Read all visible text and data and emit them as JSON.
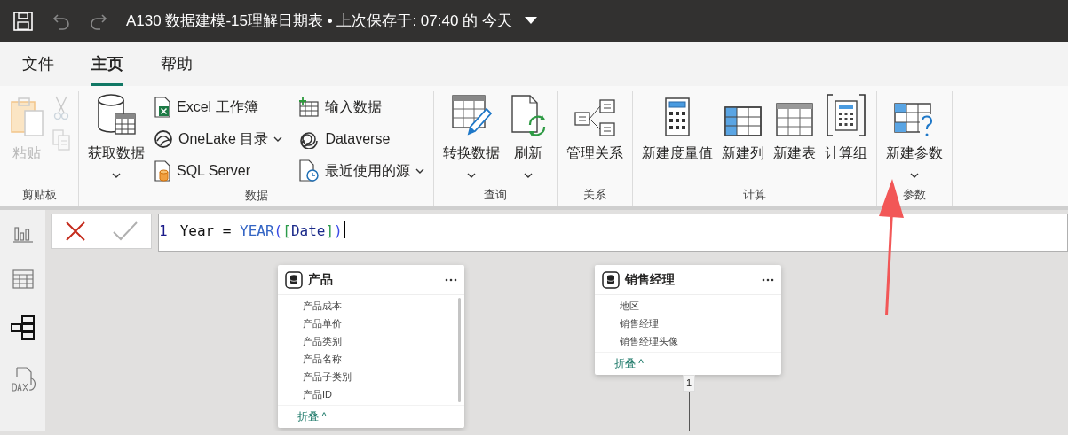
{
  "title_bar": {
    "title": "A130 数据建模-15理解日期表 • 上次保存于: 07:40 的 今天"
  },
  "menu_tabs": [
    {
      "label": "文件",
      "selected": false
    },
    {
      "label": "主页",
      "selected": true
    },
    {
      "label": "帮助",
      "selected": false
    }
  ],
  "ribbon": {
    "groups": [
      {
        "label": "剪贴板",
        "buttons": [
          {
            "kind": "large",
            "label": "粘贴",
            "disabled": true,
            "dropdown": false
          },
          {
            "kind": "icon",
            "disabled": true
          },
          {
            "kind": "icon",
            "disabled": true
          }
        ]
      },
      {
        "label": "数据",
        "buttons": [
          {
            "kind": "large",
            "label": "获取数据",
            "disabled": false,
            "dropdown": true
          },
          {
            "kind": "small",
            "label": "Excel 工作簿",
            "disabled": false,
            "dropdown": false
          },
          {
            "kind": "small",
            "label": "OneLake 目录",
            "disabled": false,
            "dropdown": true
          },
          {
            "kind": "small",
            "label": "SQL Server",
            "disabled": false,
            "dropdown": false
          },
          {
            "kind": "small",
            "label": "输入数据",
            "disabled": false,
            "dropdown": false
          },
          {
            "kind": "small",
            "label": "Dataverse",
            "disabled": false,
            "dropdown": false
          },
          {
            "kind": "small",
            "label": "最近使用的源",
            "disabled": false,
            "dropdown": true
          }
        ]
      },
      {
        "label": "查询",
        "buttons": [
          {
            "kind": "large",
            "label": "转换数据",
            "disabled": false,
            "dropdown": true
          },
          {
            "kind": "large",
            "label": "刷新",
            "disabled": false,
            "dropdown": true
          }
        ]
      },
      {
        "label": "关系",
        "buttons": [
          {
            "kind": "large",
            "label": "管理关系",
            "disabled": false,
            "dropdown": false
          }
        ]
      },
      {
        "label": "计算",
        "buttons": [
          {
            "kind": "large",
            "label": "新建度量值",
            "disabled": false,
            "dropdown": false
          },
          {
            "kind": "large",
            "label": "新建列",
            "disabled": false,
            "dropdown": false
          },
          {
            "kind": "large",
            "label": "新建表",
            "disabled": false,
            "dropdown": false
          },
          {
            "kind": "large",
            "label": "计算组",
            "disabled": false,
            "dropdown": false
          }
        ]
      },
      {
        "label": "参数",
        "buttons": [
          {
            "kind": "large",
            "label": "新建参数",
            "disabled": false,
            "dropdown": true
          }
        ]
      }
    ]
  },
  "views": [
    {
      "selected": false
    },
    {
      "selected": false
    },
    {
      "selected": true
    },
    {
      "selected": false
    }
  ],
  "formula_bar": {
    "line_number": "1",
    "tokens": [
      {
        "text": "Year = ",
        "kind": "plain"
      },
      {
        "text": "YEAR",
        "kind": "function"
      },
      {
        "text": "(",
        "kind": "paren"
      },
      {
        "text": "[",
        "kind": "bracket"
      },
      {
        "text": "Date",
        "kind": "column"
      },
      {
        "text": "]",
        "kind": "bracket"
      },
      {
        "text": ")",
        "kind": "paren"
      }
    ]
  },
  "tables": [
    {
      "name": "产品",
      "fields": [
        "产品成本",
        "产品单价",
        "产品类别",
        "产品名称",
        "产品子类别",
        "产品ID"
      ],
      "collapse_label": "折叠 ^",
      "scrollable": true
    },
    {
      "name": "销售经理",
      "fields": [
        "地区",
        "销售经理",
        "销售经理头像"
      ],
      "collapse_label": "折叠 ^",
      "scrollable": false,
      "relationship_label": "1"
    }
  ],
  "annotations": [
    {
      "kind": "arrow"
    }
  ]
}
